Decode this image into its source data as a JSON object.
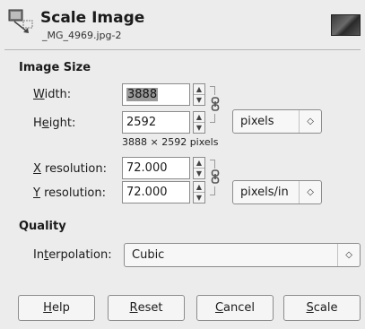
{
  "header": {
    "title": "Scale Image",
    "subtitle": "_MG_4969.jpg-2",
    "icon": "scale-image-icon"
  },
  "image_size": {
    "heading": "Image Size",
    "width_label_mnemonic": "W",
    "width_label_rest": "idth:",
    "width_value": "3888",
    "height_label_pre": "H",
    "height_label_mnemonic": "e",
    "height_label_rest": "ight:",
    "height_value": "2592",
    "unit": "pixels",
    "size_note": "3888 × 2592 pixels",
    "xres_label_mnemonic": "X",
    "xres_label_rest": " resolution:",
    "xres_value": "72.000",
    "yres_label_mnemonic": "Y",
    "yres_label_rest": " resolution:",
    "yres_value": "72.000",
    "res_unit": "pixels/in"
  },
  "quality": {
    "heading": "Quality",
    "interp_label_pre": "In",
    "interp_label_mnemonic": "t",
    "interp_label_rest": "erpolation:",
    "interpolation": "Cubic"
  },
  "buttons": {
    "help_mnemonic": "H",
    "help_rest": "elp",
    "reset_mnemonic": "R",
    "reset_rest": "eset",
    "cancel_mnemonic": "C",
    "cancel_rest": "ancel",
    "scale_mnemonic": "S",
    "scale_rest": "cale"
  },
  "icons": {
    "spin_up": "▲",
    "spin_down": "▼",
    "combo_arrow": "◇",
    "chain": "chain-link-icon"
  }
}
